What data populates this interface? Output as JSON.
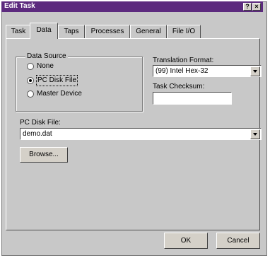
{
  "window": {
    "title": "Edit Task",
    "help_icon_label": "?",
    "close_icon_label": "×"
  },
  "tabs": [
    {
      "label": "Task",
      "active": false
    },
    {
      "label": "Data",
      "active": true
    },
    {
      "label": "Taps",
      "active": false
    },
    {
      "label": "Processes",
      "active": false
    },
    {
      "label": "General",
      "active": false
    },
    {
      "label": "File I/O",
      "active": false
    }
  ],
  "data_source": {
    "title": "Data Source",
    "options": [
      {
        "label": "None",
        "selected": false
      },
      {
        "label": "PC Disk File",
        "selected": true
      },
      {
        "label": "Master Device",
        "selected": false
      }
    ]
  },
  "translation_format": {
    "label": "Translation Format:",
    "value": "(99) Intel Hex-32"
  },
  "task_checksum": {
    "label": "Task Checksum:",
    "value": ""
  },
  "pc_disk_file": {
    "label": "PC Disk File:",
    "value": "demo.dat"
  },
  "buttons": {
    "browse": "Browse...",
    "ok": "OK",
    "cancel": "Cancel"
  }
}
